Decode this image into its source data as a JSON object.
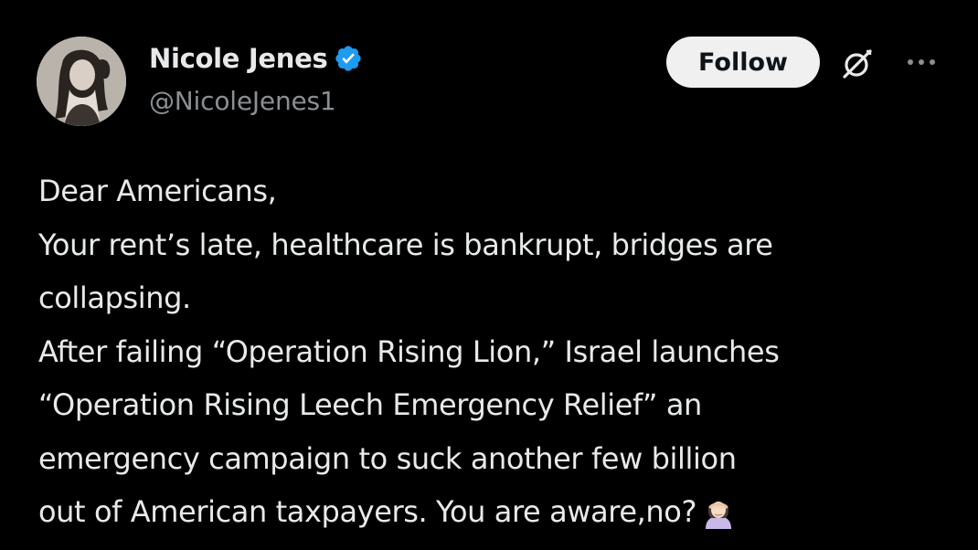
{
  "author": {
    "display_name": "Nicole Jenes",
    "handle": "@NicoleJenes1",
    "verified": true
  },
  "actions": {
    "follow_label": "Follow",
    "grok_icon": "grok-icon",
    "more_icon": "more-horizontal-icon"
  },
  "post": {
    "lines": [
      "Dear Americans,",
      "Your rent’s late, healthcare is bankrupt, bridges are",
      "collapsing.",
      "After failing “Operation Rising Lion,” Israel launches",
      "“Operation Rising Leech Emergency Relief” an",
      "emergency campaign to suck another few billion",
      "out of American taxpayers. You are aware,no?"
    ],
    "trailing_emoji": "woman-facepalming-emoji"
  },
  "colors": {
    "background": "#000000",
    "text": "#e7e9ea",
    "secondary_text": "#8b8f94",
    "verified_badge": "#1d9bf0",
    "follow_button_bg": "#f0f0f0",
    "follow_button_text": "#0f1419"
  }
}
